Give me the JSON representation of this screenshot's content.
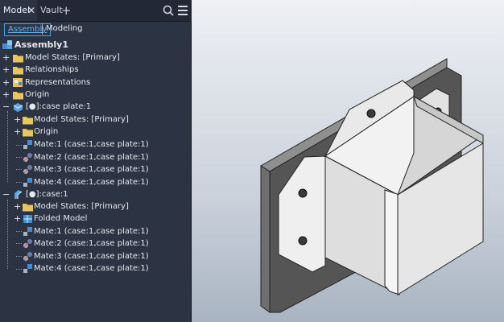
{
  "tabs": {
    "model_label": "Model",
    "close_glyph": "✕",
    "vault_label": "Vault",
    "add_glyph": "+"
  },
  "subtabs": {
    "assembly_label": "Assembly",
    "modeling_label": "Modeling"
  },
  "tree": {
    "root": "Assembly1",
    "root_model_states": "Model States: [Primary]",
    "relationships": "Relationships",
    "representations": "Representations",
    "origin": "Origin",
    "case_plate": {
      "label": "[●]:case plate:1",
      "model_states": "Model States: [Primary]",
      "origin": "Origin",
      "mates": [
        "Mate:1 (case:1,case plate:1)",
        "Mate:2 (case:1,case plate:1)",
        "Mate:3 (case:1,case plate:1)",
        "Mate:4 (case:1,case plate:1)"
      ]
    },
    "case": {
      "label": "[●]:case:1",
      "model_states": "Model States: [Primary]",
      "folded_model": "Folded Model",
      "mates": [
        "Mate:1 (case:1,case plate:1)",
        "Mate:2 (case:1,case plate:1)",
        "Mate:3 (case:1,case plate:1)",
        "Mate:4 (case:1,case plate:1)"
      ]
    }
  },
  "icons": {
    "search": "search-icon",
    "menu": "hamburger-menu-icon",
    "folder": "folder-icon",
    "assembly": "assembly-icon",
    "part": "part-icon",
    "mate": "mate-constraint-icon"
  },
  "colors": {
    "panel_bg": "#2c3444",
    "active_link": "#6ab5ee",
    "folder": "#e8c65a",
    "viewport_top": "#eef0f4",
    "viewport_bottom": "#a9b4c2"
  }
}
